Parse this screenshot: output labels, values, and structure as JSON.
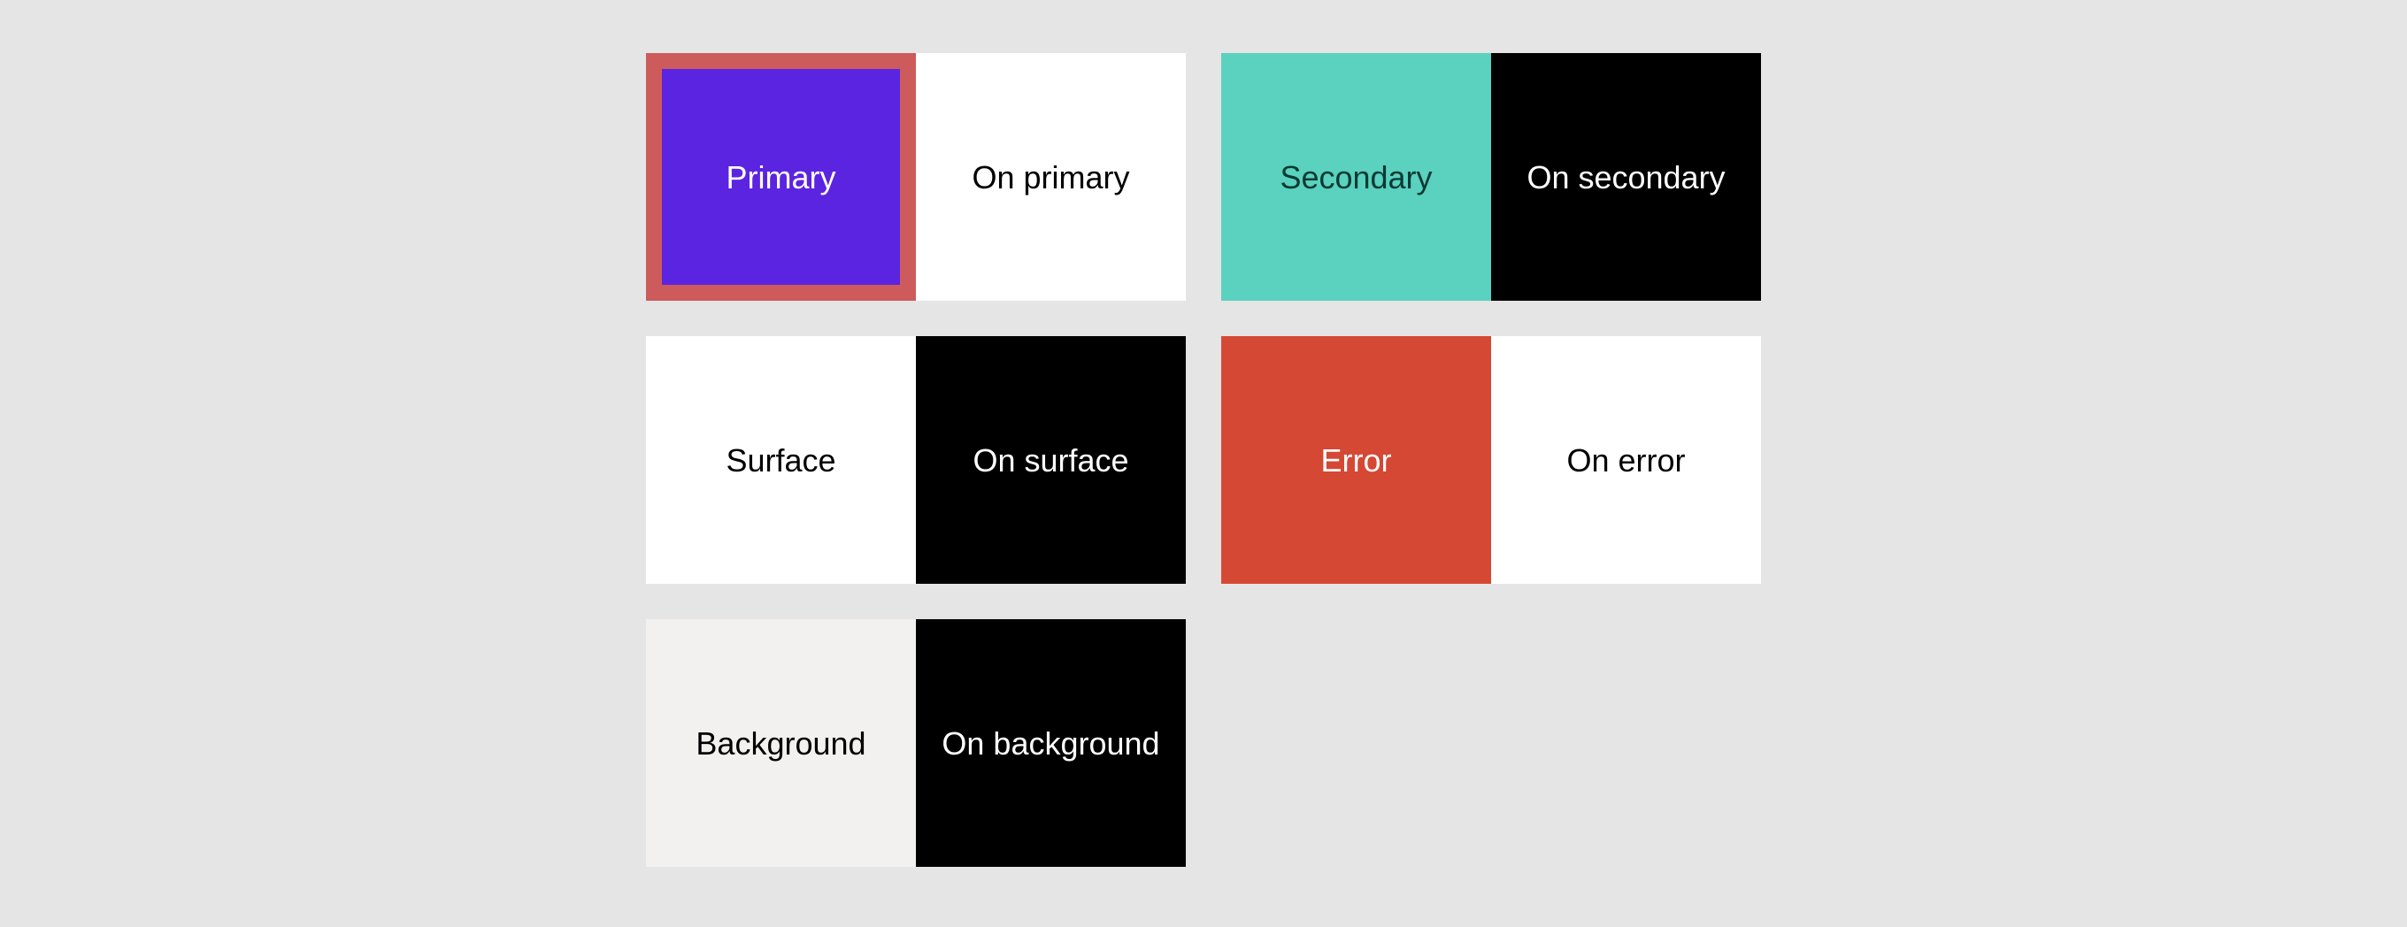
{
  "palette": {
    "selection_border_color": "#cd5b5b",
    "page_background": "#e5e5e5",
    "rows": [
      [
        {
          "id": "primary",
          "left": {
            "label": "Primary",
            "bg": "#5b24e0",
            "fg": "#ffffff",
            "selected": true
          },
          "right": {
            "label": "On primary",
            "bg": "#ffffff",
            "fg": "#000000",
            "selected": false
          }
        },
        {
          "id": "secondary",
          "left": {
            "label": "Secondary",
            "bg": "#5bd1bf",
            "fg": "#083a33",
            "selected": false
          },
          "right": {
            "label": "On secondary",
            "bg": "#000000",
            "fg": "#ffffff",
            "selected": false
          }
        }
      ],
      [
        {
          "id": "surface",
          "left": {
            "label": "Surface",
            "bg": "#ffffff",
            "fg": "#000000",
            "selected": false
          },
          "right": {
            "label": "On surface",
            "bg": "#000000",
            "fg": "#ffffff",
            "selected": false
          }
        },
        {
          "id": "error",
          "left": {
            "label": "Error",
            "bg": "#d54834",
            "fg": "#ffffff",
            "selected": false
          },
          "right": {
            "label": "On error",
            "bg": "#ffffff",
            "fg": "#000000",
            "selected": false
          }
        }
      ],
      [
        {
          "id": "background",
          "left": {
            "label": "Background",
            "bg": "#f3f0f0",
            "fg": "#000000",
            "selected": false
          },
          "right": {
            "label": "On background",
            "bg": "#000000",
            "fg": "#ffffff",
            "selected": false
          }
        }
      ]
    ]
  }
}
